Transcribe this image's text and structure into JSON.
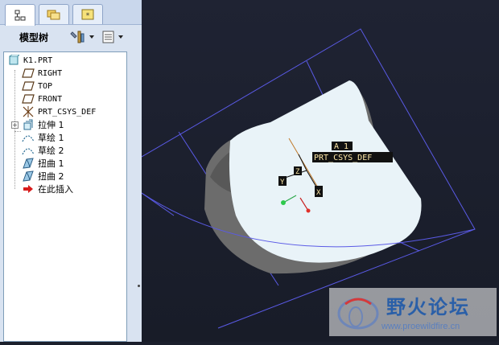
{
  "left_panel": {
    "tabs": [
      {
        "icon": "model-tree-tab-icon"
      },
      {
        "icon": "folder-browser-tab-icon"
      },
      {
        "icon": "favorites-tab-icon"
      }
    ],
    "title": "模型树",
    "settings_icon": "tools-icon",
    "show_icon": "list-icon",
    "tree": [
      {
        "label": "K1.PRT",
        "icon": "part-icon"
      },
      {
        "label": "RIGHT",
        "icon": "datum-plane-icon"
      },
      {
        "label": "TOP",
        "icon": "datum-plane-icon"
      },
      {
        "label": "FRONT",
        "icon": "datum-plane-icon"
      },
      {
        "label": "PRT_CSYS_DEF",
        "icon": "csys-icon"
      },
      {
        "label": "拉伸 1",
        "icon": "extrude-icon"
      },
      {
        "label": "草绘 1",
        "icon": "sketch-icon"
      },
      {
        "label": "草绘 2",
        "icon": "sketch-icon"
      },
      {
        "label": "扭曲 1",
        "icon": "warp-icon"
      },
      {
        "label": "扭曲 2",
        "icon": "warp-icon"
      },
      {
        "label": "在此插入",
        "icon": "insert-here-arrow-icon"
      }
    ]
  },
  "viewport": {
    "labels": {
      "axis": "A_1",
      "csys": "PRT_CSYS_DEF",
      "x": "X",
      "y": "Y",
      "z": "Z"
    }
  },
  "watermark": {
    "title": "野火论坛",
    "url": "www.proewildfire.cn"
  },
  "colors": {
    "viewport_bg": "#1b1f2c",
    "datum_plane": "#5a5ae6",
    "part_surface": "#e9f3f8",
    "part_shadow": "#6f6f6f",
    "axis_line": "#c07a2b",
    "panel_bg": "#d9e3f1"
  }
}
